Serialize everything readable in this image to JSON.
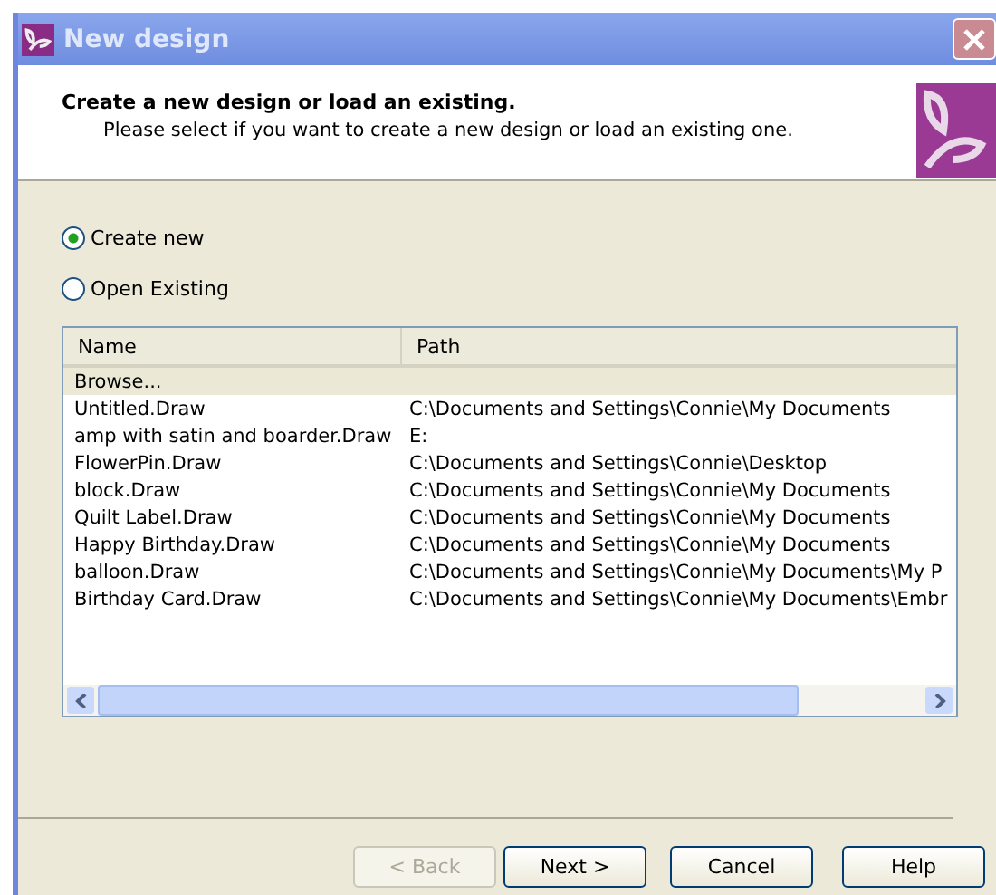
{
  "window": {
    "title": "New design"
  },
  "header": {
    "title": "Create a new design or load an existing.",
    "subtitle": "Please select if you want to create a new design or load an existing one."
  },
  "options": [
    {
      "label": "Create new",
      "selected": true
    },
    {
      "label": "Open Existing",
      "selected": false
    }
  ],
  "table": {
    "columns": [
      "Name",
      "Path"
    ],
    "rows": [
      {
        "name": "Browse...",
        "path": "",
        "selected": true
      },
      {
        "name": "Untitled.Draw",
        "path": "C:\\Documents and Settings\\Connie\\My Documents",
        "selected": false
      },
      {
        "name": "amp with satin and boarder.Draw",
        "path": "E:",
        "selected": false
      },
      {
        "name": "FlowerPin.Draw",
        "path": "C:\\Documents and Settings\\Connie\\Desktop",
        "selected": false
      },
      {
        "name": "block.Draw",
        "path": "C:\\Documents and Settings\\Connie\\My Documents",
        "selected": false
      },
      {
        "name": "Quilt Label.Draw",
        "path": "C:\\Documents and Settings\\Connie\\My Documents",
        "selected": false
      },
      {
        "name": "Happy Birthday.Draw",
        "path": "C:\\Documents and Settings\\Connie\\My Documents",
        "selected": false
      },
      {
        "name": "balloon.Draw",
        "path": "C:\\Documents and Settings\\Connie\\My Documents\\My P",
        "selected": false
      },
      {
        "name": "Birthday Card.Draw",
        "path": "C:\\Documents and Settings\\Connie\\My Documents\\Embr",
        "selected": false
      }
    ]
  },
  "buttons": [
    {
      "label": "< Back",
      "disabled": true
    },
    {
      "label": "Next >",
      "disabled": false
    },
    {
      "label": "Cancel",
      "disabled": false
    },
    {
      "label": "Help",
      "disabled": false
    }
  ]
}
